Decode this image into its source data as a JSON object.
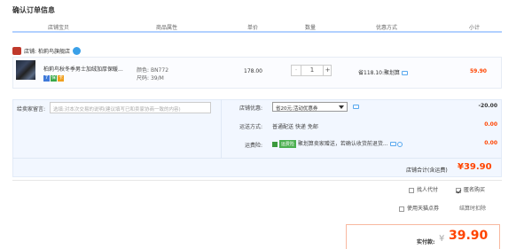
{
  "section_title": "确认订单信息",
  "columns": [
    "店铺宝贝",
    "商品属性",
    "单价",
    "数量",
    "优惠方式",
    "小计"
  ],
  "shop": {
    "label": "店铺:",
    "name": "柏莉鸟旗舰店"
  },
  "item": {
    "name": "柏莉鸟秋冬季男士加绒加厚保暖...",
    "badges": [
      "7",
      "保",
      "卡"
    ],
    "color_label": "颜色:",
    "color_value": "BN772",
    "size_label": "尺码:",
    "size_value": "39/M",
    "price": "178.00",
    "qty_minus": "-",
    "qty": "1",
    "qty_plus": "+",
    "promo": "省118.10:聚划算",
    "subtotal": "59.90"
  },
  "options": {
    "message_label": "给卖家留言:",
    "message_placeholder": "选填:对本次交易的说明(建议填写已和卖家协商一致的内容)",
    "store_discount_label": "店铺优惠:",
    "store_discount_select": "省20元:活动优惠券",
    "store_discount_value": "-20.00",
    "shipping_label": "运送方式:",
    "shipping_value": "普通配送 快递 免邮",
    "shipping_cost": "0.00",
    "insurance_label": "运费险:",
    "insurance_tag": "运费险",
    "insurance_text": "聚划算卖家赠送，若确认收货前退货...",
    "insurance_cost": "0.00"
  },
  "store_total": {
    "label": "店铺合计(含运费)",
    "value": "¥39.90"
  },
  "checkout_options": {
    "proxy_pay": "找人代付",
    "anonymous": "匿名购买",
    "tmall_points": "使用天猫点券",
    "points_note": "结算时扣除"
  },
  "final": {
    "label": "实付款:",
    "currency": "¥",
    "value": "39.90"
  },
  "colors": {
    "accent": "#ff4400",
    "header_line": "#b2d1ff",
    "panel_bg": "#f2f7ff"
  }
}
